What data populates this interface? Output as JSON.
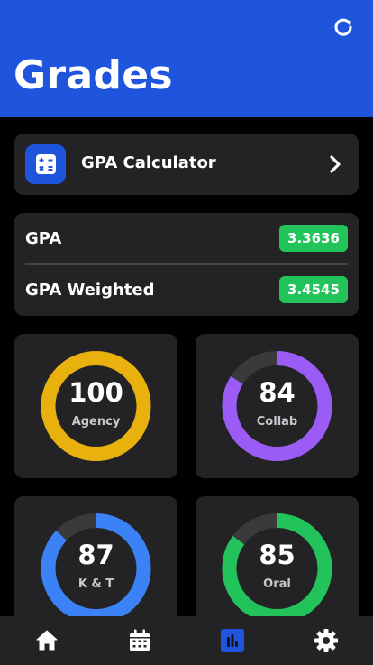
{
  "header": {
    "title": "Grades",
    "refresh_icon": "refresh-icon",
    "color": "#1f55dc"
  },
  "calculator": {
    "label": "GPA Calculator",
    "icon": "calculator-icon",
    "chevron_icon": "chevron-right-icon"
  },
  "gpa": {
    "label": "GPA",
    "value": "3.3636",
    "weighted_label": "GPA Weighted",
    "weighted_value": "3.4545",
    "badge_color": "#22c35a"
  },
  "scores": [
    {
      "value": "100",
      "label": "Agency",
      "percent": 100,
      "color": "#e8b10e"
    },
    {
      "value": "84",
      "label": "Collab",
      "percent": 84,
      "color": "#9b5cf6"
    },
    {
      "value": "87",
      "label": "K & T",
      "percent": 87,
      "color": "#3b82f6"
    },
    {
      "value": "85",
      "label": "Oral",
      "percent": 85,
      "color": "#22c35a"
    }
  ],
  "nav": {
    "items": [
      {
        "icon": "home-icon",
        "active": false
      },
      {
        "icon": "calendar-icon",
        "active": false
      },
      {
        "icon": "bar-chart-icon",
        "active": true
      },
      {
        "icon": "settings-icon",
        "active": false
      }
    ]
  }
}
